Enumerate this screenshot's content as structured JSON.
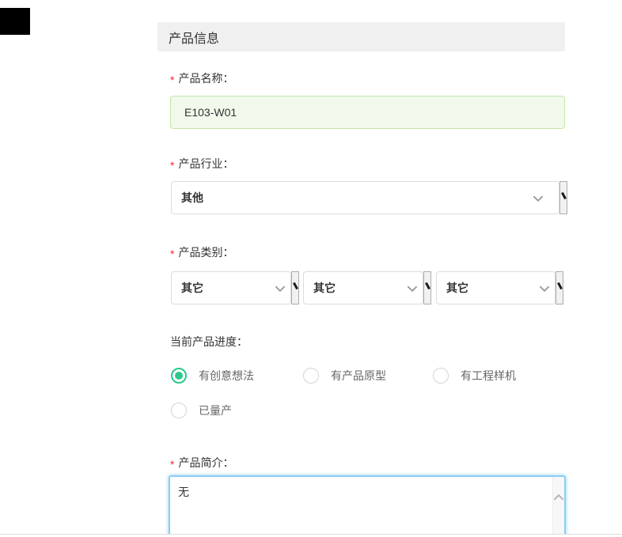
{
  "header": {
    "title": "产品信息"
  },
  "misc": {
    "asterisk": "*"
  },
  "fields": {
    "product_name": {
      "required": true,
      "label": "产品名称：",
      "value": "E103-W01"
    },
    "product_industry": {
      "required": true,
      "label": "产品行业：",
      "selected": "其他"
    },
    "product_category": {
      "required": true,
      "label": "产品类别：",
      "selects": [
        "其它",
        "其它",
        "其它"
      ]
    },
    "product_progress": {
      "label": "当前产品进度：",
      "options": [
        {
          "label": "有创意想法",
          "selected": true
        },
        {
          "label": "有产品原型",
          "selected": false
        },
        {
          "label": "有工程样机",
          "selected": false
        },
        {
          "label": "已量产",
          "selected": false
        }
      ]
    },
    "product_intro": {
      "required": true,
      "label": "产品简介：",
      "value": "无"
    }
  },
  "colors": {
    "header_bg": "#f0f0f0",
    "required_red": "#f02d2d",
    "success_input_bg": "#f0f9eb",
    "success_input_border": "#c3e6a8",
    "radio_green": "#2bc88c",
    "focus_blue": "#8ccdf3",
    "select_border": "#dcdcdc"
  }
}
